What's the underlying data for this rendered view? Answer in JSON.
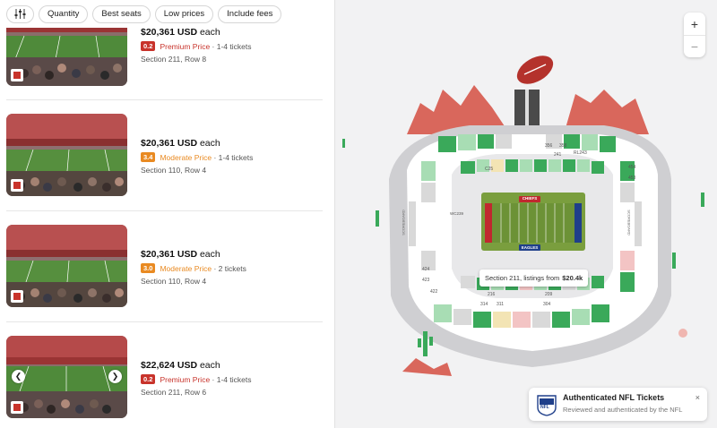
{
  "filters": {
    "quantity": "Quantity",
    "best_seats": "Best seats",
    "low_prices": "Low prices",
    "include_fees": "Include fees"
  },
  "listings": [
    {
      "price": "$20,361 USD",
      "each": "each",
      "score": "0.2",
      "tier": "Premium Price",
      "tier_color": "red",
      "tickets": "1-4 tickets",
      "section": "Section 211, Row 8"
    },
    {
      "price": "$20,361 USD",
      "each": "each",
      "score": "3.4",
      "tier": "Moderate Price",
      "tier_color": "orange",
      "tickets": "1-4 tickets",
      "section": "Section 110, Row 4"
    },
    {
      "price": "$20,361 USD",
      "each": "each",
      "score": "3.0",
      "tier": "Moderate Price",
      "tier_color": "orange",
      "tickets": "2 tickets",
      "section": "Section 110, Row 4"
    },
    {
      "price": "$22,624 USD",
      "each": "each",
      "score": "0.2",
      "tier": "Premium Price",
      "tier_color": "red",
      "tickets": "1-4 tickets",
      "section": "Section 211, Row 6"
    }
  ],
  "map": {
    "zoom_in": "+",
    "zoom_out": "−",
    "end_top": "CHIEFS",
    "end_bottom": "EAGLES",
    "sections": [
      "356",
      "358",
      "241",
      "RL243",
      "C25",
      "454",
      "453",
      "WC239",
      "424",
      "423",
      "422",
      "216",
      "209",
      "314",
      "311",
      "304"
    ],
    "scoreboard_left": "SCOREBOARD",
    "scoreboard_right": "SCOREBOARD",
    "tooltip_prefix": "Section 211, listings from",
    "tooltip_price": "$20.4k"
  },
  "toast": {
    "title": "Authenticated NFL Tickets",
    "subtitle": "Reviewed and authenticated by the NFL",
    "close": "×",
    "logo_text": "NFL"
  },
  "colors": {
    "premium": "#c8332b",
    "moderate": "#e98a22",
    "field": "#7a9e3e",
    "seat_green": "#3aa95a",
    "seat_light": "#a8ddb4"
  }
}
